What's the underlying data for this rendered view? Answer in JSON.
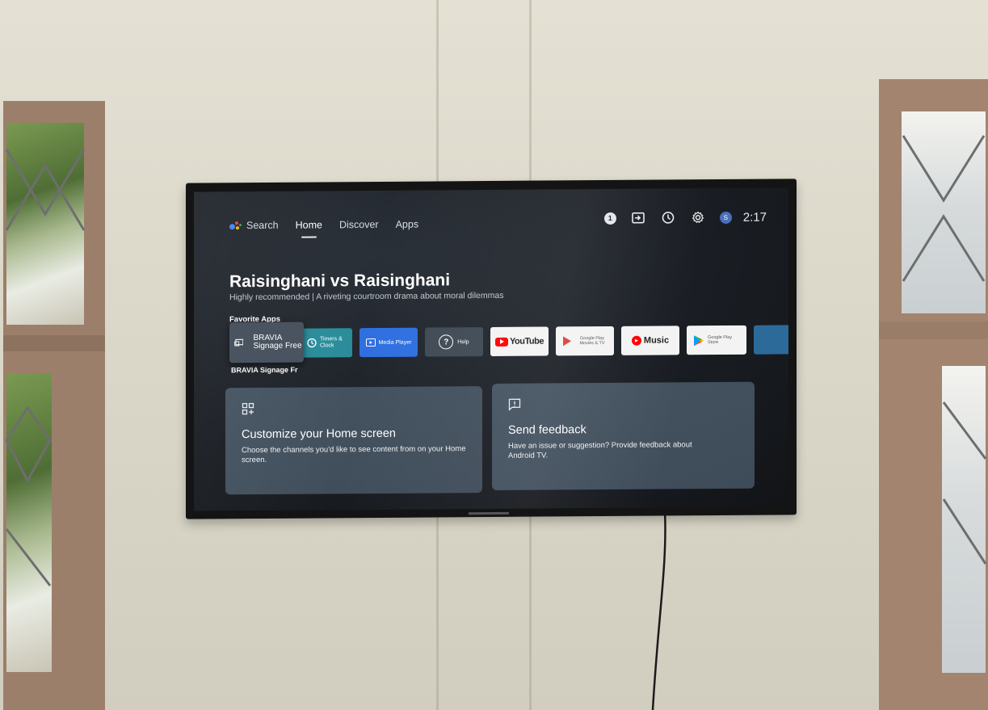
{
  "tv": {
    "topnav": {
      "search_label": "Search",
      "tabs": [
        {
          "label": "Home",
          "active": true
        },
        {
          "label": "Discover",
          "active": false
        },
        {
          "label": "Apps",
          "active": false
        }
      ]
    },
    "status": {
      "notification_count": "1",
      "icons": [
        "input-icon",
        "timer-icon",
        "settings-icon"
      ],
      "profile_initial": "S",
      "time": "2:17"
    },
    "hero": {
      "title": "Raisinghani vs Raisinghani",
      "subtitle": "Highly recommended | A riveting courtroom drama about moral dilemmas"
    },
    "favorite_apps": {
      "row_title": "Favorite Apps",
      "focused_app": "BRAVIA Signage Free",
      "focused_caption": "BRAVIA Signage Fr",
      "apps": [
        {
          "name": "Timers & Clock",
          "color": "#2a8c9a"
        },
        {
          "name": "Media Player",
          "color": "#2f6fe0"
        },
        {
          "name": "Help",
          "color": "#3f4a55"
        },
        {
          "name": "YouTube",
          "color": "#f3f3f3"
        },
        {
          "name": "Google Play Movies & TV",
          "color": "#f3f3f3"
        },
        {
          "name": "Music",
          "color": "#f3f3f3"
        },
        {
          "name": "Google Play Store",
          "color": "#f3f3f3"
        }
      ]
    },
    "cards": {
      "customize": {
        "title": "Customize your Home screen",
        "body": "Choose the channels you'd like to see content from on your Home screen."
      },
      "feedback": {
        "title": "Send feedback",
        "body": "Have an issue or suggestion? Provide feedback about Android TV."
      }
    }
  }
}
